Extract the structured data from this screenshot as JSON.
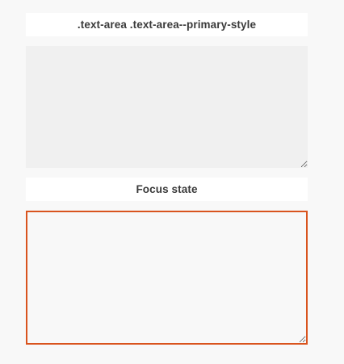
{
  "sections": [
    {
      "label": ".text-area .text-area--primary-style",
      "textarea": {
        "value": "",
        "placeholder": ""
      }
    },
    {
      "label": "Focus state",
      "textarea": {
        "value": "",
        "placeholder": ""
      }
    }
  ],
  "colors": {
    "page_background": "#f8f8f8",
    "label_background": "#ffffff",
    "label_text": "#3a3a3a",
    "textarea_default_background": "#f0f0f0",
    "focus_border": "#d9541e"
  }
}
